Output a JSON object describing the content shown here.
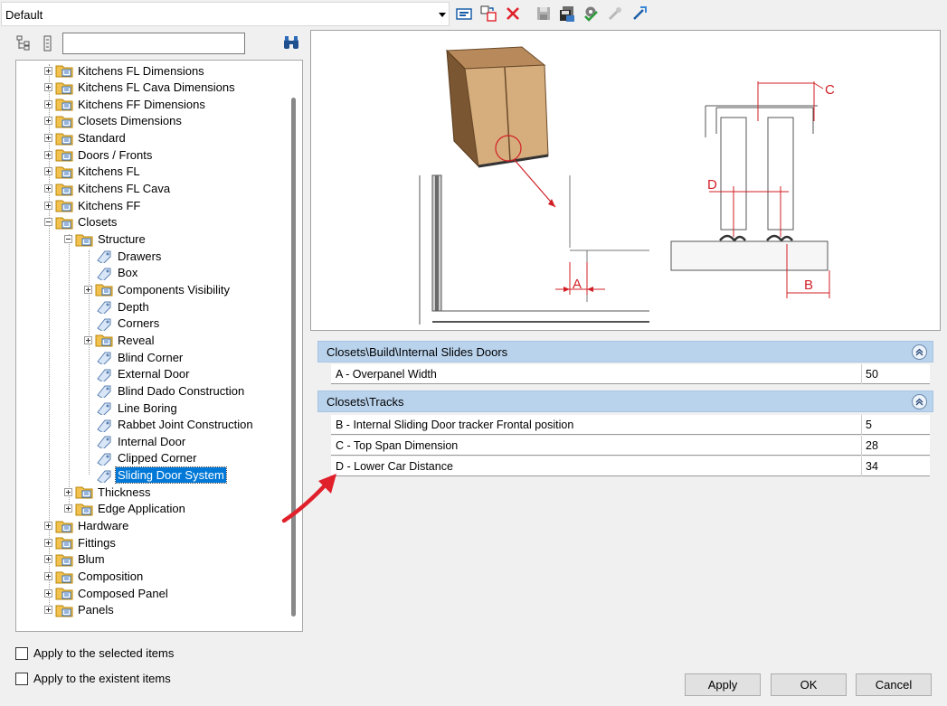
{
  "preset": {
    "value": "Default"
  },
  "toolbar": {
    "icons": [
      "properties-icon",
      "copy-icon",
      "delete-icon",
      "save-icon",
      "save-all-icon",
      "settings-check-icon",
      "tool-icon",
      "link-icon"
    ]
  },
  "tree": {
    "search_value": "",
    "items": [
      {
        "label": "Kitchens FL Dimensions",
        "level": 0,
        "type": "folder",
        "expander": "plus"
      },
      {
        "label": "Kitchens FL Cava Dimensions",
        "level": 0,
        "type": "folder",
        "expander": "plus"
      },
      {
        "label": "Kitchens FF Dimensions",
        "level": 0,
        "type": "folder",
        "expander": "plus"
      },
      {
        "label": "Closets Dimensions",
        "level": 0,
        "type": "folder",
        "expander": "plus"
      },
      {
        "label": "Standard",
        "level": 0,
        "type": "folder",
        "expander": "plus"
      },
      {
        "label": "Doors / Fronts",
        "level": 0,
        "type": "folder",
        "expander": "plus"
      },
      {
        "label": "Kitchens FL",
        "level": 0,
        "type": "folder",
        "expander": "plus"
      },
      {
        "label": "Kitchens FL Cava",
        "level": 0,
        "type": "folder",
        "expander": "plus"
      },
      {
        "label": "Kitchens FF",
        "level": 0,
        "type": "folder",
        "expander": "plus"
      },
      {
        "label": "Closets",
        "level": 0,
        "type": "folder",
        "expander": "minus"
      },
      {
        "label": "Structure",
        "level": 1,
        "type": "folder",
        "expander": "minus"
      },
      {
        "label": "Drawers",
        "level": 2,
        "type": "tag",
        "expander": "none"
      },
      {
        "label": "Box",
        "level": 2,
        "type": "tag",
        "expander": "none"
      },
      {
        "label": "Components Visibility",
        "level": 2,
        "type": "folder",
        "expander": "plus"
      },
      {
        "label": "Depth",
        "level": 2,
        "type": "tag",
        "expander": "none"
      },
      {
        "label": "Corners",
        "level": 2,
        "type": "tag",
        "expander": "none"
      },
      {
        "label": "Reveal",
        "level": 2,
        "type": "folder",
        "expander": "plus"
      },
      {
        "label": "Blind Corner",
        "level": 2,
        "type": "tag",
        "expander": "none"
      },
      {
        "label": "External Door",
        "level": 2,
        "type": "tag",
        "expander": "none"
      },
      {
        "label": "Blind Dado Construction",
        "level": 2,
        "type": "tag",
        "expander": "none"
      },
      {
        "label": "Line Boring",
        "level": 2,
        "type": "tag",
        "expander": "none"
      },
      {
        "label": "Rabbet Joint Construction",
        "level": 2,
        "type": "tag",
        "expander": "none"
      },
      {
        "label": "Internal Door",
        "level": 2,
        "type": "tag",
        "expander": "none"
      },
      {
        "label": "Clipped Corner",
        "level": 2,
        "type": "tag",
        "expander": "none"
      },
      {
        "label": "Sliding Door System",
        "level": 2,
        "type": "tag",
        "expander": "none",
        "selected": true
      },
      {
        "label": "Thickness",
        "level": 1,
        "type": "folder",
        "expander": "plus"
      },
      {
        "label": "Edge Application",
        "level": 1,
        "type": "folder",
        "expander": "plus"
      },
      {
        "label": "Hardware",
        "level": 0,
        "type": "folder",
        "expander": "plus"
      },
      {
        "label": "Fittings",
        "level": 0,
        "type": "folder",
        "expander": "plus"
      },
      {
        "label": "Blum",
        "level": 0,
        "type": "folder",
        "expander": "plus"
      },
      {
        "label": "Composition",
        "level": 0,
        "type": "folder",
        "expander": "plus"
      },
      {
        "label": "Composed Panel",
        "level": 0,
        "type": "folder",
        "expander": "plus"
      },
      {
        "label": "Panels",
        "level": 0,
        "type": "folder",
        "expander": "plus"
      }
    ]
  },
  "options": {
    "apply_selected": "Apply to the selected items",
    "apply_existent": "Apply to the existent items"
  },
  "preview": {
    "labels": {
      "a": "A",
      "b": "B",
      "c": "C",
      "d": "D"
    }
  },
  "groups": [
    {
      "title": "Closets\\Build\\Internal Slides Doors",
      "rows": [
        {
          "name": "A - Overpanel Width",
          "value": "50"
        }
      ]
    },
    {
      "title": "Closets\\Tracks",
      "rows": [
        {
          "name": "B -  Internal Sliding Door tracker Frontal position",
          "value": "5"
        },
        {
          "name": "C -  Top Span Dimension",
          "value": "28"
        },
        {
          "name": "D -  Lower Car Distance",
          "value": "34"
        }
      ]
    }
  ],
  "buttons": {
    "apply": "Apply",
    "ok": "OK",
    "cancel": "Cancel"
  },
  "colors": {
    "accent_red": "#e0202a",
    "group_header": "#b9d3ec",
    "selection": "#0078d7"
  }
}
